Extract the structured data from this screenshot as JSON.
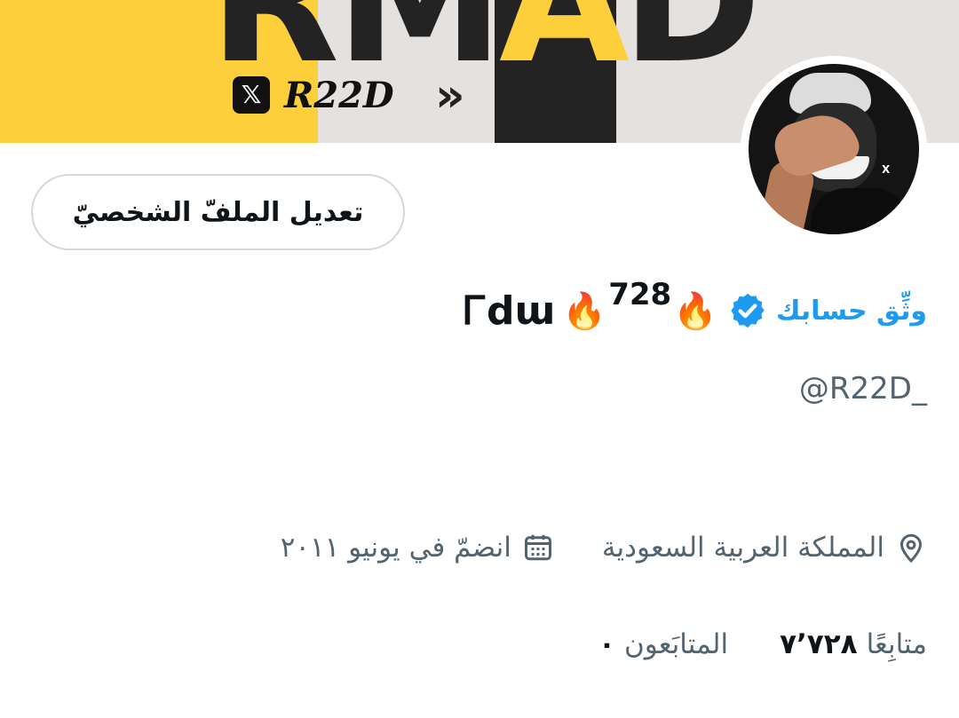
{
  "banner": {
    "big_text_rm": "RM",
    "big_text_a": "A",
    "big_text_d": "D",
    "x_logo": "𝕏",
    "brand": "R22D",
    "chevrons": "»",
    "colors": {
      "yellow": "#fccf3b",
      "grey": "#e4e1df",
      "dark": "#232323"
    }
  },
  "avatar": {
    "watermark": "X"
  },
  "actions": {
    "edit_profile_label": "تعديل الملفّ الشخصيّ"
  },
  "profile": {
    "verify_link": "وثِّق حسابك",
    "verify_icon": "verified-badge-icon",
    "name_fire_1": "🔥",
    "name_number": "728",
    "name_fire_2": "🔥",
    "name_text": "Ꮁdɯ",
    "handle": "@R22D_",
    "accent_color": "#1d9bf0"
  },
  "meta": {
    "location_icon": "location-pin-icon",
    "location": "المملكة العربية السعودية",
    "calendar_icon": "calendar-icon",
    "joined": "انضمّ في يونيو ٢٠١١"
  },
  "stats": {
    "followers_count": "٠",
    "followers_label": "المتابَعون",
    "following_count": "٧٬٧٢٨",
    "following_label": "متابِعًا"
  }
}
